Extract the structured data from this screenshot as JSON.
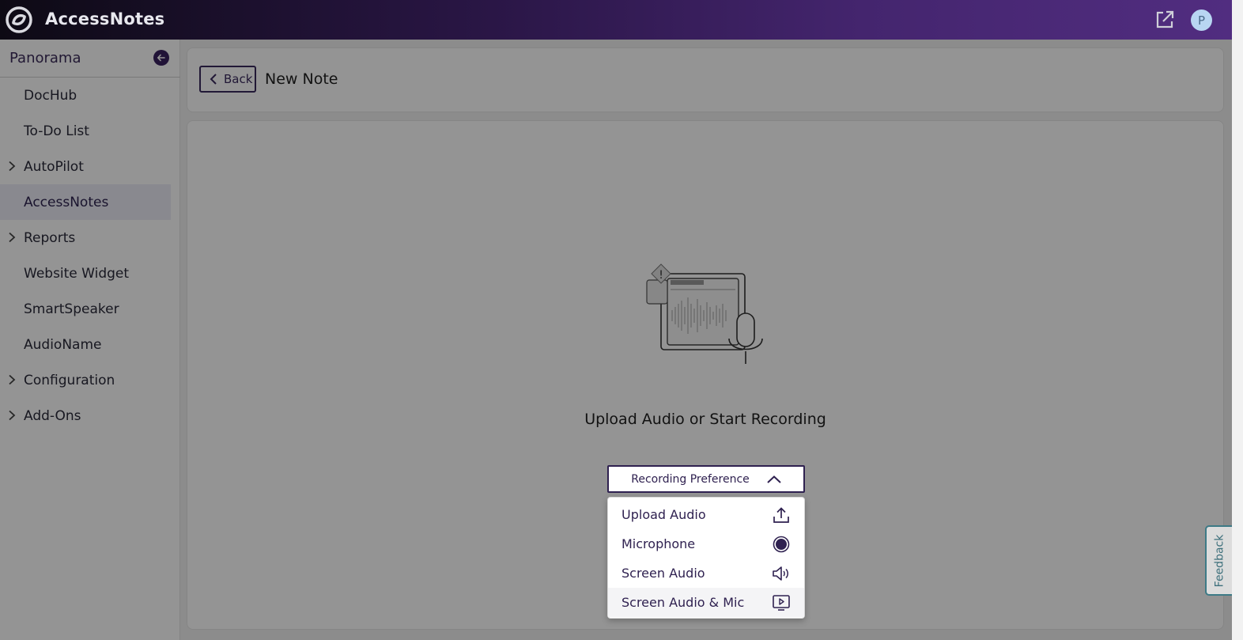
{
  "header": {
    "app_title": "AccessNotes",
    "avatar_initial": "P",
    "external_link_icon": "external-link-icon",
    "logo_icon": "app-logo"
  },
  "sidebar": {
    "title": "Panorama",
    "items": [
      {
        "label": "DocHub",
        "expandable": false,
        "active": false
      },
      {
        "label": "To-Do List",
        "expandable": false,
        "active": false
      },
      {
        "label": "AutoPilot",
        "expandable": true,
        "active": false
      },
      {
        "label": "AccessNotes",
        "expandable": false,
        "active": true
      },
      {
        "label": "Reports",
        "expandable": true,
        "active": false
      },
      {
        "label": "Website Widget",
        "expandable": false,
        "active": false
      },
      {
        "label": "SmartSpeaker",
        "expandable": false,
        "active": false
      },
      {
        "label": "AudioName",
        "expandable": false,
        "active": false
      },
      {
        "label": "Configuration",
        "expandable": true,
        "active": false
      },
      {
        "label": "Add-Ons",
        "expandable": true,
        "active": false
      }
    ]
  },
  "main": {
    "back_label": "Back",
    "page_title": "New Note",
    "prompt": "Upload Audio or Start Recording",
    "recording_preference": {
      "label": "Recording Preference",
      "options": [
        {
          "label": "Upload Audio",
          "icon": "upload-icon"
        },
        {
          "label": "Microphone",
          "icon": "record-icon"
        },
        {
          "label": "Screen Audio",
          "icon": "speaker-icon"
        },
        {
          "label": "Screen Audio & Mic",
          "icon": "screen-play-icon"
        }
      ]
    }
  },
  "feedback_label": "Feedback",
  "colors": {
    "brand_dark": "#2a1646",
    "brand_purple": "#512d80",
    "accent": "#3a2260",
    "feedback_teal": "#3d7a86"
  }
}
